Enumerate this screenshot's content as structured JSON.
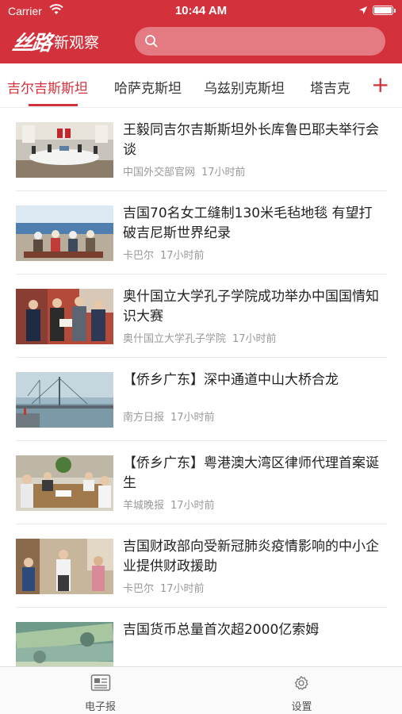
{
  "status_bar": {
    "carrier": "Carrier",
    "time": "10:44 AM"
  },
  "header": {
    "logo_brand": "丝路",
    "logo_name": "新观察",
    "search_placeholder": ""
  },
  "colors": {
    "brand_red": "#d3323c",
    "search_bg": "#e57b82",
    "meta_gray": "#999999"
  },
  "channels": {
    "tabs": [
      {
        "label": "吉尔吉斯斯坦",
        "active": true
      },
      {
        "label": "哈萨克斯坦",
        "active": false
      },
      {
        "label": "乌兹别克斯坦",
        "active": false
      },
      {
        "label": "塔吉克",
        "active": false
      }
    ],
    "add_label": "+"
  },
  "articles": [
    {
      "title": "王毅同吉尔吉斯斯坦外长库鲁巴耶夫举行会谈",
      "source": "中国外交部官网",
      "time": "17小时前",
      "image": "meeting-photo"
    },
    {
      "title": "吉国70名女工缝制130米毛毡地毯 有望打破吉尼斯世界纪录",
      "source": "卡巴尔",
      "time": "17小时前",
      "image": "lakeside-group-photo"
    },
    {
      "title": "奥什国立大学孔子学院成功举办中国国情知识大赛",
      "source": "奥什国立大学孔子学院",
      "time": "17小时前",
      "image": "award-ceremony-photo"
    },
    {
      "title": "【侨乡广东】深中通道中山大桥合龙",
      "source": "南方日报",
      "time": "17小时前",
      "image": "bridge-construction-photo"
    },
    {
      "title": "【侨乡广东】粤港澳大湾区律师代理首案诞生",
      "source": "羊城晚报",
      "time": "17小时前",
      "image": "office-meeting-photo"
    },
    {
      "title": "吉国财政部向受新冠肺炎疫情影响的中小企业提供财政援助",
      "source": "卡巴尔",
      "time": "17小时前",
      "image": "shop-interview-photo"
    },
    {
      "title": "吉国货币总量首次超2000亿索姆",
      "source": "",
      "time": "",
      "image": "banknotes-photo"
    }
  ],
  "tabbar": {
    "newspaper_label": "电子报",
    "settings_label": "设置"
  },
  "icons": [
    "wifi-icon",
    "location-arrow-icon",
    "battery-icon",
    "search-icon",
    "plus-icon",
    "newspaper-icon",
    "gear-icon"
  ]
}
